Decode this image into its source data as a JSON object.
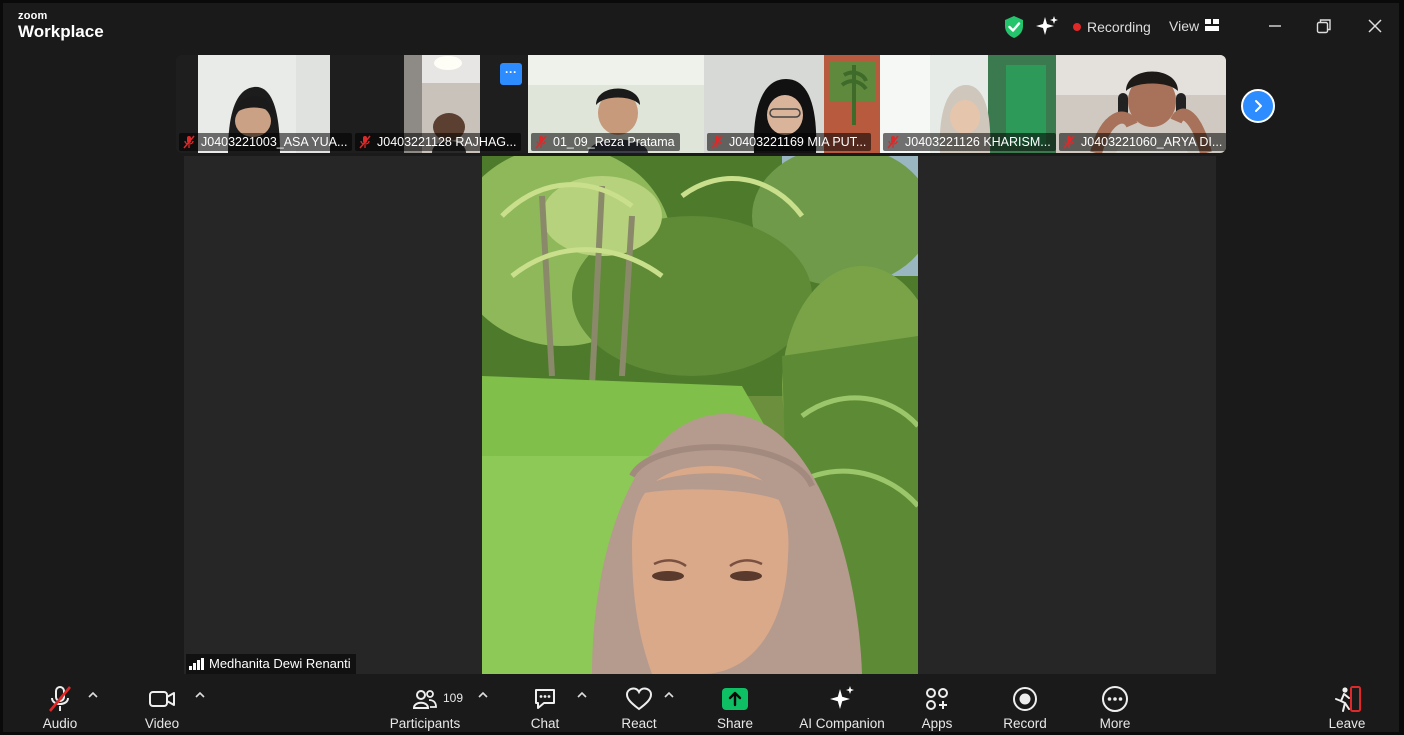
{
  "app": {
    "logo_small": "zoom",
    "logo_big": "Workplace"
  },
  "titlebar": {
    "recording_label": "Recording",
    "view_label": "View",
    "icons": [
      "shield-check-icon",
      "sparkle-icon",
      "minimize-icon",
      "restore-icon",
      "close-icon"
    ]
  },
  "thumbnails": [
    {
      "name": "J0403221003_ASA YUA...",
      "muted": true
    },
    {
      "name": "J0403221128 RAJHAG...",
      "muted": true
    },
    {
      "name": "01_09_Reza Pratama",
      "muted": true
    },
    {
      "name": "J0403221169 MIA PUT...",
      "muted": true
    },
    {
      "name": "J0403221126 KHARISM...",
      "muted": true
    },
    {
      "name": "J0403221060_ARYA DI...",
      "muted": true
    }
  ],
  "thumb_more_label": "···",
  "speaker": {
    "name": "Medhanita Dewi Renanti"
  },
  "toolbar": {
    "audio": "Audio",
    "video": "Video",
    "participants": "Participants",
    "participants_count": "109",
    "chat": "Chat",
    "react": "React",
    "share": "Share",
    "ai_companion": "AI Companion",
    "apps": "Apps",
    "record": "Record",
    "more": "More",
    "leave": "Leave"
  },
  "colors": {
    "accent_blue": "#2d8cff",
    "share_green": "#0fbf64",
    "muted_red": "#e02828",
    "leave_red": "#e02828"
  }
}
